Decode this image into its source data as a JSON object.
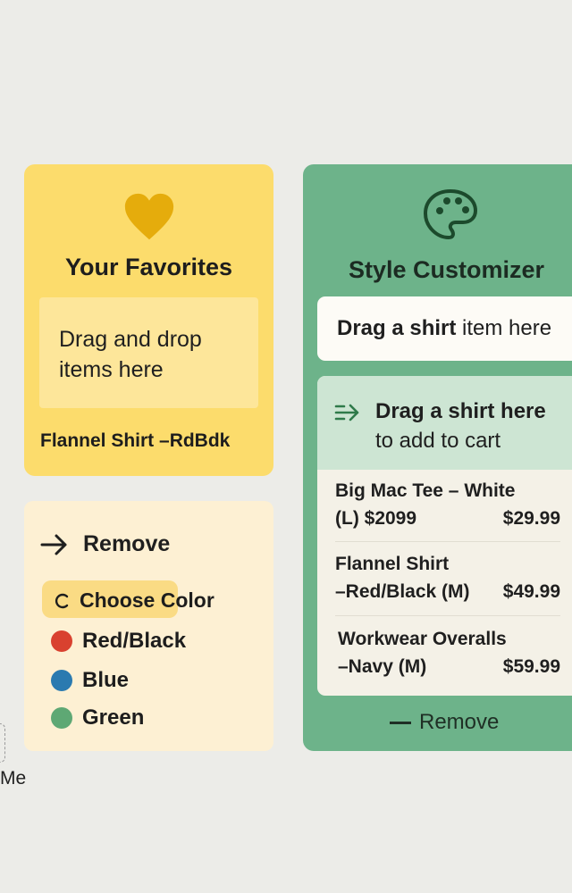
{
  "favorites": {
    "icon": "heart-icon",
    "icon_color": "#e5ac0c",
    "title": "Your Favorites",
    "drop_text": "Drag and drop items here",
    "item": "Flannel Shirt –RdBdk"
  },
  "color_options": {
    "remove_label": "Remove",
    "choose_label": "Choose Color",
    "options": [
      {
        "label": "Red/Black",
        "color": "#d9412f"
      },
      {
        "label": "Blue",
        "color": "#2a7ab0"
      },
      {
        "label": "Green",
        "color": "#5ea874"
      }
    ]
  },
  "partial_label": "Me",
  "style_customizer": {
    "icon": "palette-icon",
    "title": "Style Customizer",
    "drag_prefix": "Drag a shirt",
    "drag_suffix": " item here",
    "cart_text_1": "Drag a shirt here",
    "cart_text_2": "to add to cart",
    "items": [
      {
        "line1": "Big Mac Tee – White",
        "line2": "(L) $2099",
        "price": "$29.99"
      },
      {
        "line1": "Flannel Shirt",
        "line2": "–Red/Black (M)",
        "price": "$49.99"
      },
      {
        "line1": "Workwear Overalls",
        "line2": "–Navy (M)",
        "price": "$59.99"
      }
    ],
    "remove_label": "Remove"
  }
}
